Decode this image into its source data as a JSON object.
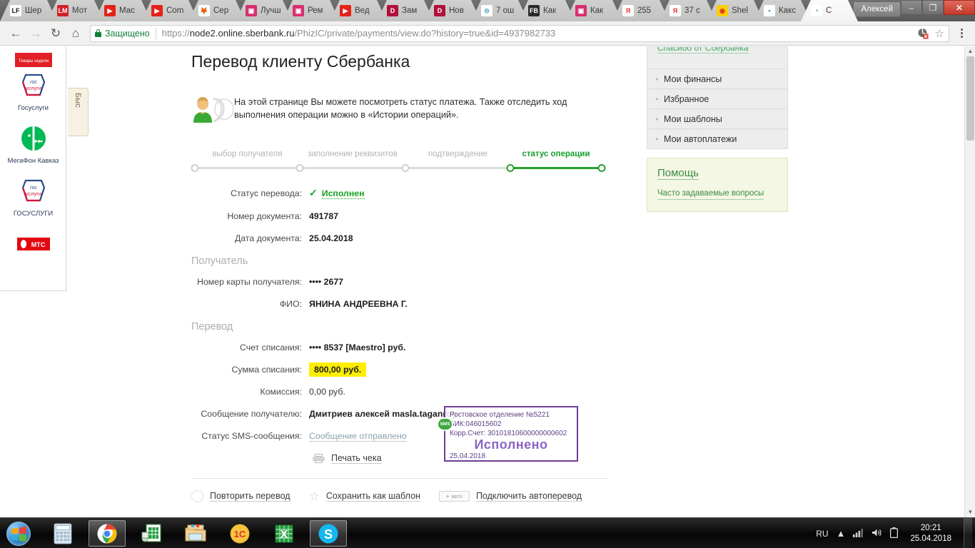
{
  "browser": {
    "tabs": [
      {
        "title": "Шер",
        "favicon": "lf-icon",
        "fav_text": "LF",
        "fav_bg": "#ffffff",
        "fav_color": "#111111"
      },
      {
        "title": "Мот",
        "favicon": "liqui-moly-icon",
        "fav_text": "LM",
        "fav_bg": "#d42027",
        "fav_color": "#ffffff"
      },
      {
        "title": "Мас",
        "favicon": "youtube-icon",
        "fav_text": "▶",
        "fav_bg": "#e62117",
        "fav_color": "#ffffff"
      },
      {
        "title": "Com",
        "favicon": "youtube-icon",
        "fav_text": "▶",
        "fav_bg": "#e62117",
        "fav_color": "#ffffff"
      },
      {
        "title": "Сер",
        "favicon": "fox-icon",
        "fav_text": "🦊",
        "fav_bg": "#ffffff",
        "fav_color": "#e8803a"
      },
      {
        "title": "Лучш",
        "favicon": "instagram-icon",
        "fav_text": "▣",
        "fav_bg": "#d6306f",
        "fav_color": "#ffffff"
      },
      {
        "title": "Рем",
        "favicon": "instagram-icon",
        "fav_text": "▣",
        "fav_bg": "#d6306f",
        "fav_color": "#ffffff"
      },
      {
        "title": "Вед",
        "favicon": "youtube-icon",
        "fav_text": "▶",
        "fav_bg": "#e62117",
        "fav_color": "#ffffff"
      },
      {
        "title": "Зам",
        "favicon": "drom-icon",
        "fav_text": "D",
        "fav_bg": "#b10f3c",
        "fav_color": "#ffffff"
      },
      {
        "title": "Нов",
        "favicon": "drom-icon",
        "fav_text": "D",
        "fav_bg": "#b10f3c",
        "fav_color": "#ffffff"
      },
      {
        "title": "7 ош",
        "favicon": "generic-icon",
        "fav_text": "⊖",
        "fav_bg": "#ffffff",
        "fav_color": "#4aa8c8"
      },
      {
        "title": "Как",
        "favicon": "facebook-icon",
        "fav_text": "FB",
        "fav_bg": "#2b2b2b",
        "fav_color": "#ffffff"
      },
      {
        "title": "Как",
        "favicon": "instagram-icon",
        "fav_text": "▣",
        "fav_bg": "#d6306f",
        "fav_color": "#ffffff"
      },
      {
        "title": "255",
        "favicon": "yandex-icon",
        "fav_text": "Я",
        "fav_bg": "#ffffff",
        "fav_color": "#e03226"
      },
      {
        "title": "37 с",
        "favicon": "yandex-icon",
        "fav_text": "Я",
        "fav_bg": "#ffffff",
        "fav_color": "#e03226"
      },
      {
        "title": "Shel",
        "favicon": "shell-icon",
        "fav_text": "◉",
        "fav_bg": "#fbce07",
        "fav_color": "#e03226"
      },
      {
        "title": "Какс",
        "favicon": "dot-icon",
        "fav_text": "•",
        "fav_bg": "#ffffff",
        "fav_color": "#3b8fd6"
      },
      {
        "title": "С",
        "favicon": "sberbank-icon",
        "fav_text": "◔",
        "fav_bg": "#ffffff",
        "fav_color": "#21a038",
        "active": true
      }
    ],
    "tab_close_glyph": "×",
    "window": {
      "user_label": "Алексей",
      "minimize": "–",
      "maximize": "❐",
      "close": "✕"
    },
    "toolbar": {
      "back": "←",
      "forward": "→",
      "reload": "↻",
      "home": "⌂",
      "secure_label": "Защищено",
      "url_prefix": "https://",
      "url_host": "node2.online.sberbank.ru",
      "url_path": "/PhizIC/private/payments/view.do?history=true&id=4937982733",
      "star": "☆"
    }
  },
  "bookmarks_panel": {
    "items": [
      {
        "label": "",
        "name": "promo-bookmark",
        "kind": "promo"
      },
      {
        "label": "Госуслуги",
        "name": "gosuslugi-bookmark",
        "kind": "gosuslugi"
      },
      {
        "label": "МегаФон Кавказ",
        "name": "megafon-bookmark",
        "kind": "megafon"
      },
      {
        "label": "ГОСУСЛУГИ",
        "name": "gosuslugi2-bookmark",
        "kind": "gosuslugi"
      },
      {
        "label": "",
        "name": "mts-bookmark",
        "kind": "mts",
        "logo_text": "МТС"
      }
    ],
    "side_tab_label": "Быс"
  },
  "page": {
    "title": "Перевод клиенту Сбербанка",
    "intro": "На этой странице Вы можете посмотреть статус платежа. Также отследить ход выполнения операции можно в «Истории операций».",
    "stepper": {
      "steps": [
        {
          "label": "выбор получателя",
          "done": false
        },
        {
          "label": "заполнение реквизитов",
          "done": false
        },
        {
          "label": "подтверждение",
          "done": false
        },
        {
          "label": "статус операции",
          "done": true
        }
      ]
    },
    "fields": [
      {
        "label": "Статус перевода:",
        "value": "Исполнен",
        "style": "status"
      },
      {
        "label": "Номер документа:",
        "value": "491787",
        "style": "bold"
      },
      {
        "label": "Дата документа:",
        "value": "25.04.2018",
        "style": "bold"
      }
    ],
    "section_recipient": "Получатель",
    "recipient_fields": [
      {
        "label": "Номер карты получателя:",
        "value": "•••• 2677",
        "style": "bold"
      },
      {
        "label": "ФИО:",
        "value": "ЯНИНА АНДРЕЕВНА Г.",
        "style": "bold"
      }
    ],
    "section_transfer": "Перевод",
    "transfer_fields": [
      {
        "label": "Счет списания:",
        "value": "•••• 8537  [Maestro]  руб.",
        "style": "bold"
      },
      {
        "label": "Сумма списания:",
        "value": "800,00  руб.",
        "style": "highlight"
      },
      {
        "label": "Комиссия:",
        "value": "0,00 руб.",
        "style": "normal"
      },
      {
        "label": "Сообщение получателю:",
        "value": "Дмитриев алексей masla.taganrog",
        "style": "bold"
      },
      {
        "label": "Статус SMS-сообщения:",
        "value": "Сообщение отправлено",
        "style": "link-dot"
      }
    ],
    "stamp": {
      "line1": "Ростовское отделение №5221",
      "line2": "БИК:046015602",
      "line3": "Корр.Счет: 30101810600000000602",
      "big": "Исполнено",
      "date": "25.04.2018",
      "badge": "SMS",
      "color": "#6c3f96"
    },
    "print_link": "Печать чека",
    "actions": [
      {
        "label": "Повторить перевод",
        "icon": "repeat-icon"
      },
      {
        "label": "Сохранить как шаблон",
        "icon": "star-icon"
      },
      {
        "label": "Подключить автоперевод",
        "icon": "auto-badge-icon",
        "badge_plus": "+",
        "badge_text": "авто"
      }
    ]
  },
  "sidebar": {
    "top_link": "Спасибо от Сбербанка",
    "items": [
      {
        "label": "Мои финансы"
      },
      {
        "label": "Избранное"
      },
      {
        "label": "Мои шаблоны"
      },
      {
        "label": "Мои автоплатежи"
      }
    ],
    "arrow_glyph": "▸",
    "help": {
      "title": "Помощь",
      "link": "Часто задаваемые вопросы"
    }
  },
  "taskbar": {
    "start_name": "start-orb",
    "items": [
      {
        "name": "calculator-taskbar-item",
        "glyph": "calc"
      },
      {
        "name": "chrome-taskbar-item",
        "glyph": "chrome",
        "running": true
      },
      {
        "name": "excel-viewer-taskbar-item",
        "glyph": "xls-green"
      },
      {
        "name": "explorer-taskbar-item",
        "glyph": "folder"
      },
      {
        "name": "1c-taskbar-item",
        "glyph": "1c"
      },
      {
        "name": "excel-taskbar-item",
        "glyph": "x-green"
      },
      {
        "name": "skype-taskbar-item",
        "glyph": "skype",
        "running": true
      }
    ],
    "tray": {
      "language": "RU",
      "show_hidden": "▲",
      "network": "network-icon",
      "volume": "volume-icon",
      "battery": "battery-icon",
      "time": "20:21",
      "date": "25.04.2018"
    }
  }
}
